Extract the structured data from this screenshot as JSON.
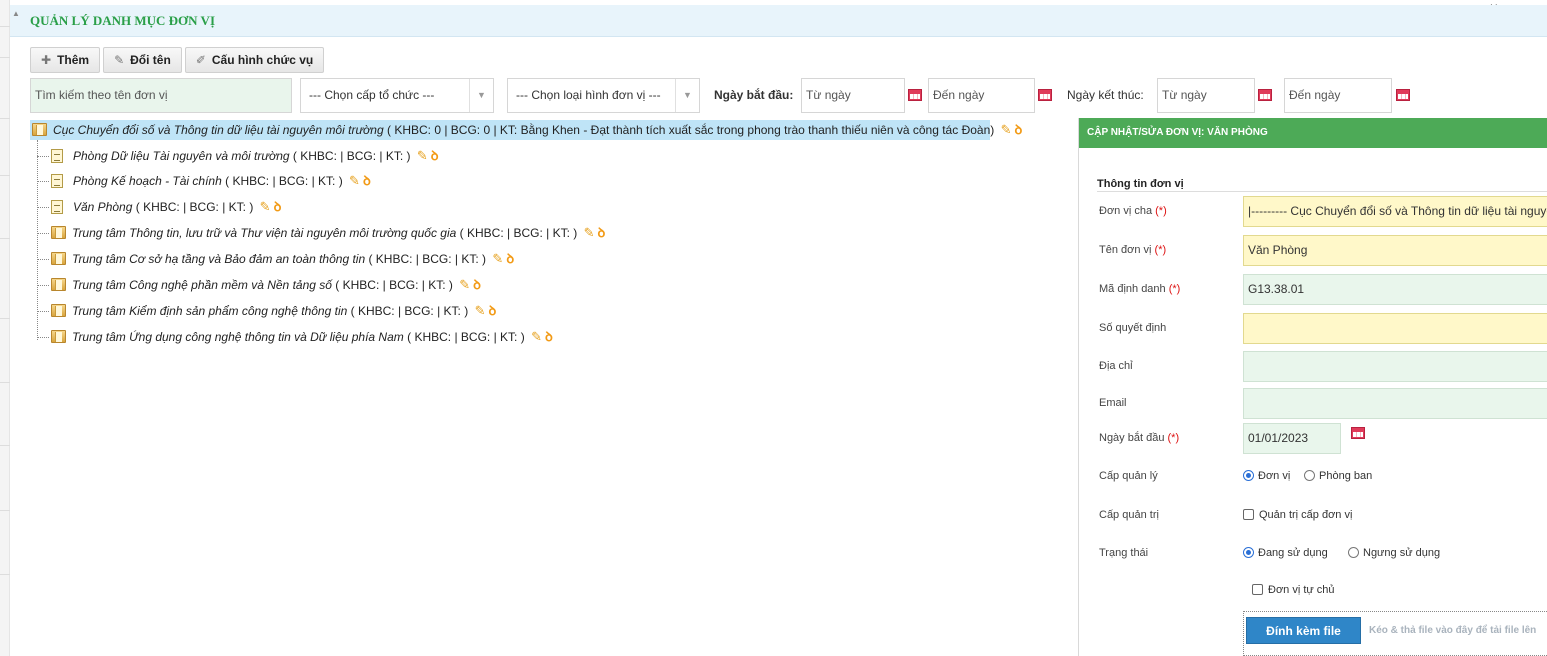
{
  "page": {
    "title": "QUẢN LÝ DANH MỤC ĐƠN VỊ"
  },
  "toolbar": {
    "add_label": "Thêm",
    "rename_label": "Đổi tên",
    "config_label": "Cấu hình chức vụ"
  },
  "filters": {
    "search_placeholder": "Tìm kiếm theo tên đơn vị",
    "level_select": "--- Chọn cấp tổ chức ---",
    "type_select": "--- Chọn loại hình đơn vị ---",
    "start_label": "Ngày bắt đầu:",
    "end_label": "Ngày kết thúc:",
    "from_placeholder": "Từ ngày",
    "to_placeholder": "Đến ngày"
  },
  "tree": {
    "root": {
      "name": "Cục Chuyển đổi số và Thông tin dữ liệu tài nguyên môi trường",
      "meta": "( KHBC: 0  | BCG: 0  | KT: Bằng Khen - Đạt thành tích xuất sắc trong phong trào thanh thiếu niên và công tác Đoàn)"
    },
    "children": [
      {
        "name": "Phòng Dữ liệu Tài nguyên và môi trường",
        "meta": "( KHBC:  | BCG:  | KT: )",
        "kind": "doc"
      },
      {
        "name": "Phòng Kế hoạch - Tài chính",
        "meta": "( KHBC:  | BCG:  | KT: )",
        "kind": "doc"
      },
      {
        "name": "Văn Phòng",
        "meta": "( KHBC:  | BCG:  | KT: )",
        "kind": "doc"
      },
      {
        "name": "Trung tâm Thông tin, lưu trữ và Thư viện tài nguyên môi trường quốc gia",
        "meta": "( KHBC:  | BCG:  | KT: )",
        "kind": "folder"
      },
      {
        "name": "Trung tâm Cơ sở hạ tầng và Bảo đảm an toàn thông tin",
        "meta": "( KHBC:  | BCG:  | KT: )",
        "kind": "folder"
      },
      {
        "name": "Trung tâm Công nghệ phần mềm và Nền tảng số",
        "meta": "( KHBC:  | BCG:  | KT: )",
        "kind": "folder"
      },
      {
        "name": "Trung tâm Kiểm định sản phẩm công nghệ thông tin",
        "meta": "( KHBC:  | BCG:  | KT: )",
        "kind": "folder"
      },
      {
        "name": "Trung tâm Ứng dụng công nghệ thông tin và Dữ liệu phía Nam",
        "meta": "( KHBC:  | BCG:  | KT: )",
        "kind": "folder"
      }
    ]
  },
  "panel": {
    "header": "CẬP NHẬT/SỬA ĐƠN VỊ: VĂN PHÒNG",
    "section": "Thông tin đơn vị",
    "required_mark": "(*)",
    "fields": {
      "parent_label": "Đơn vị cha",
      "parent_value": "|--------- Cục Chuyển đổi số và Thông tin dữ liệu tài nguyên môi trường",
      "name_label": "Tên đơn vị",
      "name_value": "Văn Phòng",
      "code_label": "Mã định danh",
      "code_value": "G13.38.01",
      "decision_label": "Số quyết định",
      "decision_value": "",
      "address_label": "Địa chỉ",
      "address_value": "",
      "email_label": "Email",
      "email_value": "",
      "start_label": "Ngày bắt đầu",
      "start_value": "01/01/2023",
      "mgmt_label": "Cấp quản lý",
      "mgmt_opt1": "Đơn vị",
      "mgmt_opt2": "Phòng ban",
      "admin_label": "Cấp quản trị",
      "admin_opt": "Quản trị cấp đơn vị",
      "status_label": "Trạng thái",
      "status_opt1": "Đang sử dụng",
      "status_opt2": "Ngưng sử dụng",
      "autonomous_opt": "Đơn vị tự chủ"
    },
    "attach_label": "Đính kèm file",
    "drop_hint": "Kéo & thả file vào đây để tải file lên"
  },
  "colors": {
    "title_green": "#2a9f48",
    "panel_header": "#4daa57",
    "root_highlight": "#bfe4f7",
    "attach_button": "#2f86c8"
  }
}
